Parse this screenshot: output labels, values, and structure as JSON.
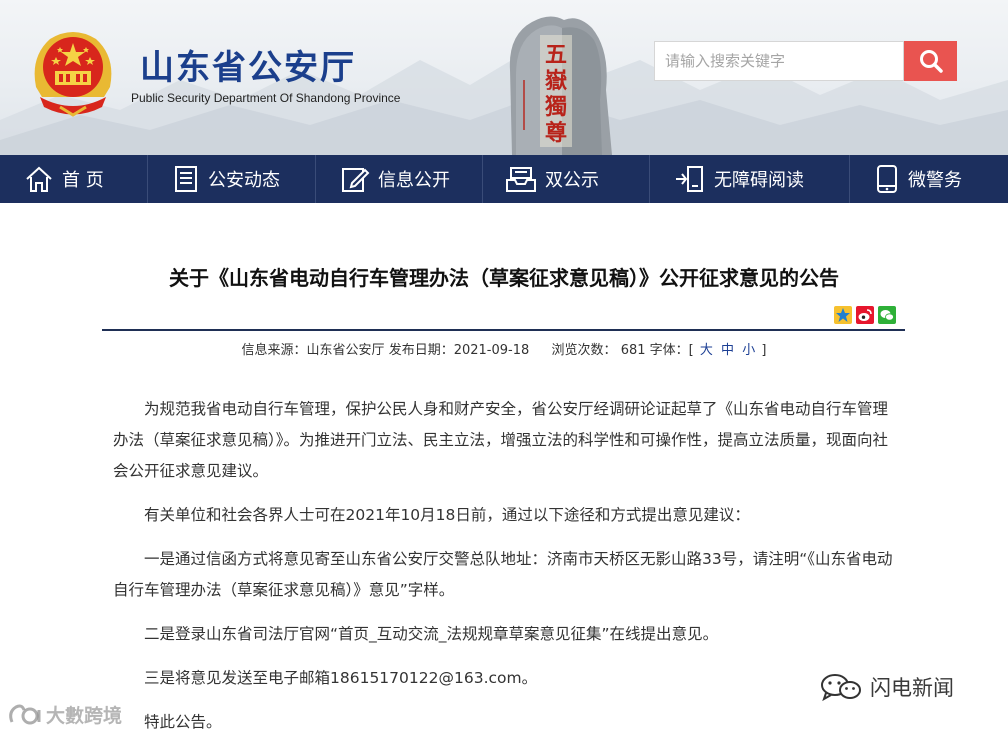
{
  "header": {
    "site_title": "山东省公安厅",
    "site_subtitle": "Public Security Department Of Shandong Province",
    "stone_text": [
      "五",
      "嶽",
      "獨",
      "尊"
    ],
    "search_placeholder": "请输入搜索关键字",
    "search_icon": "magnifier-icon",
    "search_button_color": "#e95450"
  },
  "nav": {
    "background": "#1c2f5e",
    "items": [
      {
        "label": "首 页",
        "icon": "home-icon"
      },
      {
        "label": "公安动态",
        "icon": "news-icon"
      },
      {
        "label": "信息公开",
        "icon": "edit-icon"
      },
      {
        "label": "双公示",
        "icon": "tray-icon"
      },
      {
        "label": "无障碍阅读",
        "icon": "accessibility-icon"
      },
      {
        "label": "微警务",
        "icon": "mobile-icon"
      }
    ]
  },
  "article": {
    "title": "关于《山东省电动自行车管理办法（草案征求意见稿）》公开征求意见的公告",
    "share_icons": [
      "qzone-share-icon",
      "weibo-share-icon",
      "wechat-share-icon"
    ],
    "meta": {
      "source_label": "信息来源：山东省公安厅",
      "date_label": "发布日期：2021-09-18",
      "views_label": "浏览次数：",
      "views_value": "681",
      "font_label": "字体：[",
      "font_large": "大",
      "font_medium": "中",
      "font_small": "小",
      "font_close": "]"
    },
    "paragraphs": [
      "为规范我省电动自行车管理，保护公民人身和财产安全，省公安厅经调研论证起草了《山东省电动自行车管理办法（草案征求意见稿）》。为推进开门立法、民主立法，增强立法的科学性和可操作性，提高立法质量，现面向社会公开征求意见建议。",
      "有关单位和社会各界人士可在2021年10月18日前，通过以下途径和方式提出意见建议：",
      "一是通过信函方式将意见寄至山东省公安厅交警总队地址：济南市天桥区无影山路33号，请注明“《山东省电动自行车管理办法（草案征求意见稿）》意见”字样。",
      "二是登录山东省司法厅官网“首页_互动交流_法规规章草案意见征集”在线提出意见。",
      "三是将意见发送至电子邮箱18615170122@163.com。",
      "特此公告。"
    ]
  },
  "watermarks": {
    "left": "大數跨境",
    "right": "闪电新闻"
  }
}
